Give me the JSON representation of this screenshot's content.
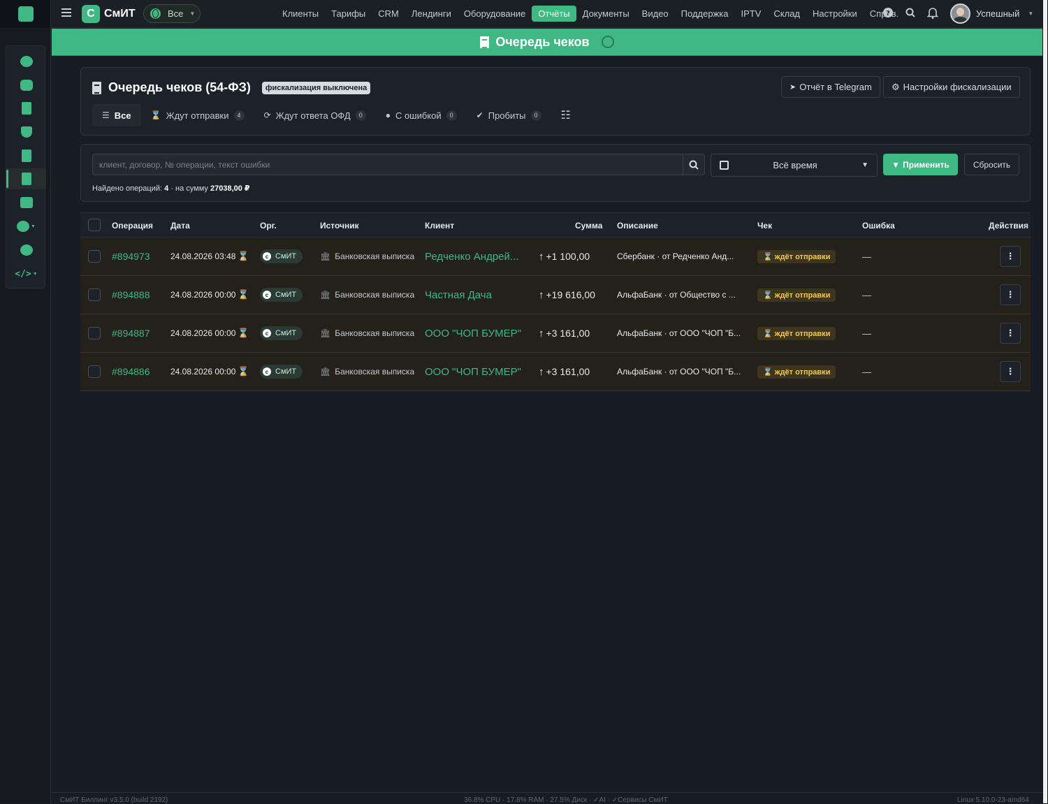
{
  "brand": {
    "letter": "С",
    "name": "СмИТ"
  },
  "org_selector": {
    "value": "Все"
  },
  "nav": [
    {
      "label": "Клиенты",
      "active": false
    },
    {
      "label": "Тарифы",
      "active": false
    },
    {
      "label": "CRM",
      "active": false
    },
    {
      "label": "Лендинги",
      "active": false
    },
    {
      "label": "Оборудование",
      "active": false
    },
    {
      "label": "Отчёты",
      "active": true
    },
    {
      "label": "Документы",
      "active": false
    },
    {
      "label": "Видео",
      "active": false
    },
    {
      "label": "Поддержка",
      "active": false
    },
    {
      "label": "IPTV",
      "active": false
    },
    {
      "label": "Склад",
      "active": false
    },
    {
      "label": "Настройки",
      "active": false
    },
    {
      "label": "Справ.",
      "active": false
    }
  ],
  "user": {
    "name": "Успешный"
  },
  "banner": {
    "title": "Очередь чеков"
  },
  "header": {
    "title": "Очередь чеков (54-ФЗ)",
    "badge": "фискализация выключена",
    "telegram_button": "Отчёт в Telegram",
    "settings_button": "Настройки фискализации"
  },
  "tabs": [
    {
      "label": "Все",
      "count": null,
      "active": true,
      "icon": "list-icon"
    },
    {
      "label": "Ждут отправки",
      "count": "4",
      "active": false,
      "icon": "hourglass-icon"
    },
    {
      "label": "Ждут ответа ОФД",
      "count": "0",
      "active": false,
      "icon": "sync-icon"
    },
    {
      "label": "С ошибкой",
      "count": "0",
      "active": false,
      "icon": "alert-icon"
    },
    {
      "label": "Пробиты",
      "count": "0",
      "active": false,
      "icon": "check-circle-icon"
    }
  ],
  "filters": {
    "search_placeholder": "клиент, договор, № операции, текст ошибки",
    "period": "Всё время",
    "apply_label": "Применить",
    "reset_label": "Сбросить",
    "found_prefix": "Найдено операций:",
    "found_count": "4",
    "found_mid": "· на сумму",
    "found_sum": "27038,00 ₽"
  },
  "table": {
    "columns": [
      "Операция",
      "Дата",
      "Орг.",
      "Источник",
      "Клиент",
      "Сумма",
      "Описание",
      "Чек",
      "Ошибка",
      "Действия"
    ],
    "rows": [
      {
        "op": "#894973",
        "date": "24.08.2026 03:48",
        "org": "СмИТ",
        "source": "Банковская выписка",
        "client": "Редченко Андрей...",
        "sum": "+1 100,00",
        "desc": "Сбербанк · от Редченко Анд...",
        "status": "ждёт отправки",
        "error": "—"
      },
      {
        "op": "#894888",
        "date": "24.08.2026 00:00",
        "org": "СмИТ",
        "source": "Банковская выписка",
        "client": "Частная Дача",
        "sum": "+19 616,00",
        "desc": "АльфаБанк · от Общество с ...",
        "status": "ждёт отправки",
        "error": "—"
      },
      {
        "op": "#894887",
        "date": "24.08.2026 00:00",
        "org": "СмИТ",
        "source": "Банковская выписка",
        "client": "ООО \"ЧОП БУМЕР\"",
        "sum": "+3 161,00",
        "desc": "АльфаБанк · от ООО \"ЧОП \"Б...",
        "status": "ждёт отправки",
        "error": "—"
      },
      {
        "op": "#894886",
        "date": "24.08.2026 00:00",
        "org": "СмИТ",
        "source": "Банковская выписка",
        "client": "ООО \"ЧОП БУМЕР\"",
        "sum": "+3 161,00",
        "desc": "АльфаБанк · от ООО \"ЧОП \"Б...",
        "status": "ждёт отправки",
        "error": "—"
      }
    ]
  },
  "footer": {
    "left": "СмИТ Биллинг v3.5.0 (build 2192)",
    "center": "36.8% CPU · 17.8% RAM · 27.5% Диск · ✓AI · ✓Сервисы СмИТ",
    "right": "Linux 5.10.0-23-amd64"
  },
  "colors": {
    "accent": "#3fb883",
    "warning": "#f5c945",
    "background": "#181c24"
  }
}
